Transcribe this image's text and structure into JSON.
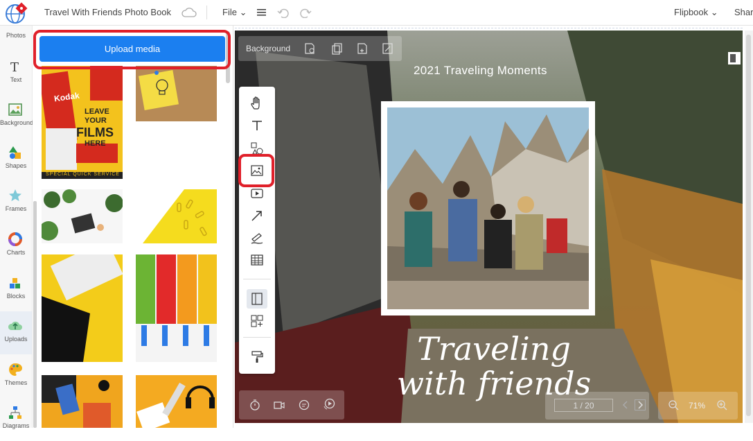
{
  "header": {
    "doc_title": "Travel With Friends Photo Book",
    "file_menu": "File",
    "flipbook_menu": "Flipbook",
    "share_menu": "Shar"
  },
  "sidebar": {
    "items": [
      {
        "label": "Photos"
      },
      {
        "label": "Text"
      },
      {
        "label": "Background"
      },
      {
        "label": "Shapes"
      },
      {
        "label": "Frames"
      },
      {
        "label": "Charts"
      },
      {
        "label": "Blocks"
      },
      {
        "label": "Uploads"
      },
      {
        "label": "Themes"
      },
      {
        "label": "Diagrams"
      }
    ],
    "active": "Uploads"
  },
  "media_panel": {
    "upload_label": "Upload media",
    "film_ad_lines": [
      "LEAVE",
      "YOUR",
      "FILMS",
      "HERE"
    ],
    "film_ad_footer": "SPECIAL QUICK SERVICE",
    "kodak_label": "Kodak"
  },
  "canvas": {
    "background_label": "Background",
    "page_title": "2021 Traveling Moments",
    "script_line1": "Traveling",
    "script_line2": "with friends",
    "page_indicator": "1 / 20",
    "zoom_level": "71%"
  },
  "colors": {
    "accent": "#1b7ff0",
    "highlight": "#e0202a"
  }
}
